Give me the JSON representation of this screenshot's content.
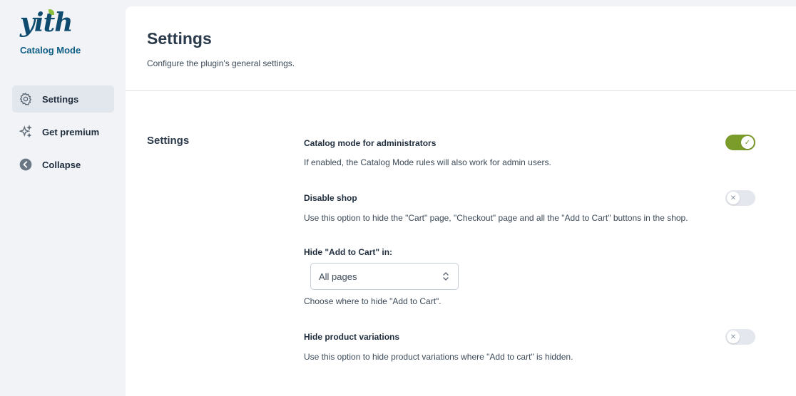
{
  "sidebar": {
    "logo_text": "yith",
    "plugin_name": "Catalog Mode",
    "items": [
      {
        "label": "Settings",
        "icon": "gear-icon",
        "active": true
      },
      {
        "label": "Get premium",
        "icon": "sparkle-icon",
        "active": false
      },
      {
        "label": "Collapse",
        "icon": "arrow-left-circle-icon",
        "active": false
      }
    ]
  },
  "header": {
    "title": "Settings",
    "description": "Configure the plugin's general settings."
  },
  "section": {
    "title": "Settings",
    "options": [
      {
        "title": "Catalog mode for administrators",
        "description": "If enabled, the Catalog Mode rules will also work for admin users.",
        "enabled": true
      },
      {
        "title": "Disable shop",
        "description": "Use this option to hide the \"Cart\" page, \"Checkout\" page and all the \"Add to Cart\" buttons in the shop.",
        "enabled": false
      },
      {
        "title": "Hide \"Add to Cart\" in:",
        "description": "Choose where to hide \"Add to Cart\".",
        "select_value": "All pages"
      },
      {
        "title": "Hide product variations",
        "description": "Use this option to hide product variations where \"Add to cart\" is hidden.",
        "enabled": false
      }
    ]
  },
  "colors": {
    "brand": "#0f4b6e",
    "toggle_on": "#7b9b2a",
    "toggle_off": "#e4e8ee"
  }
}
